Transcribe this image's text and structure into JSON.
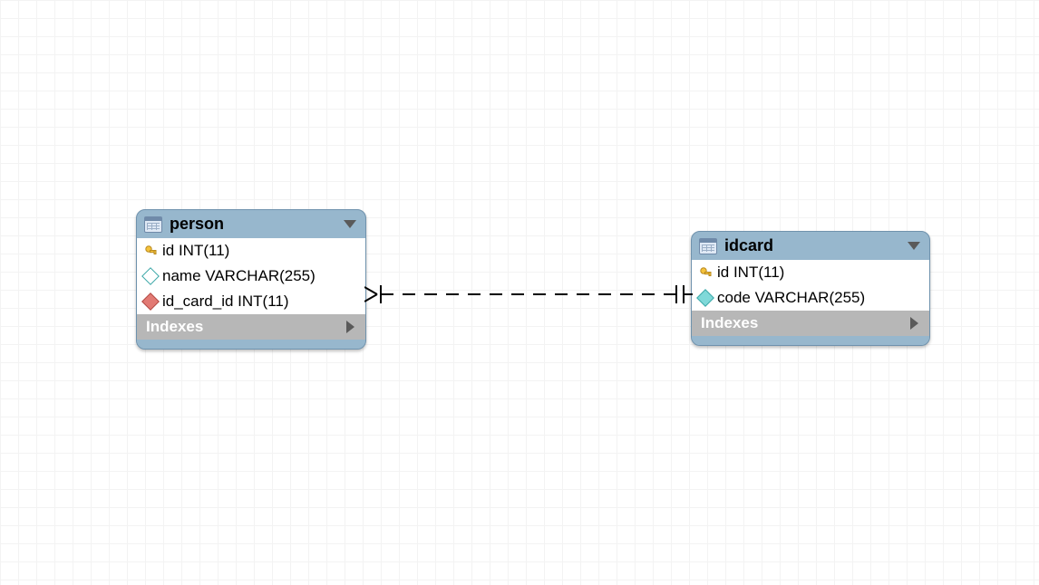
{
  "entities": {
    "person": {
      "title": "person",
      "indexes_label": "Indexes",
      "columns": [
        {
          "icon": "key",
          "text": "id INT(11)"
        },
        {
          "icon": "hollow",
          "text": "name VARCHAR(255)"
        },
        {
          "icon": "red",
          "text": "id_card_id INT(11)"
        }
      ]
    },
    "idcard": {
      "title": "idcard",
      "indexes_label": "Indexes",
      "columns": [
        {
          "icon": "key",
          "text": "id INT(11)"
        },
        {
          "icon": "cyan",
          "text": "code VARCHAR(255)"
        }
      ]
    }
  },
  "chart_data": {
    "type": "erd",
    "entities": [
      {
        "name": "person",
        "columns": [
          {
            "name": "id",
            "type": "INT(11)",
            "pk": true
          },
          {
            "name": "name",
            "type": "VARCHAR(255)",
            "nullable": true
          },
          {
            "name": "id_card_id",
            "type": "INT(11)",
            "fk": true
          }
        ]
      },
      {
        "name": "idcard",
        "columns": [
          {
            "name": "id",
            "type": "INT(11)",
            "pk": true
          },
          {
            "name": "code",
            "type": "VARCHAR(255)"
          }
        ]
      }
    ],
    "relationships": [
      {
        "from_entity": "person",
        "from_column": "id_card_id",
        "to_entity": "idcard",
        "to_column": "id",
        "cardinality": "many-to-one",
        "identifying": false
      }
    ]
  }
}
